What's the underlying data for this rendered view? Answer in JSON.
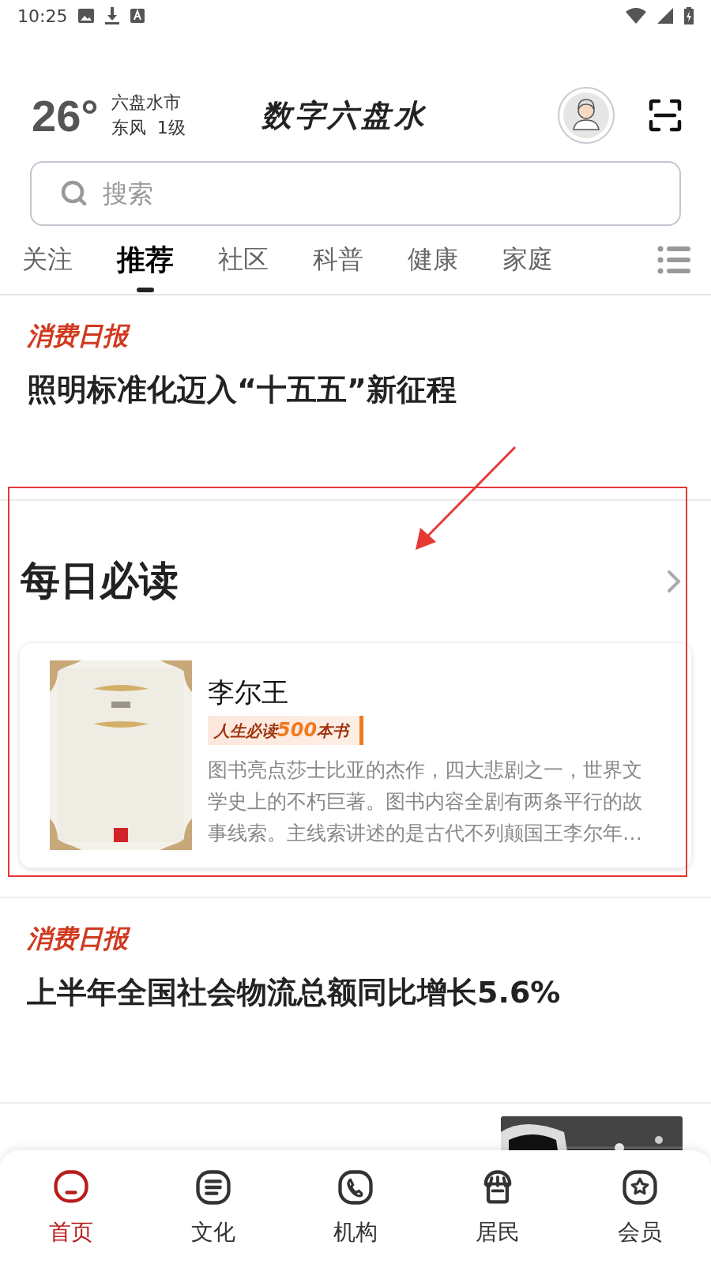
{
  "status_bar": {
    "time": "10:25"
  },
  "header": {
    "temperature": "26°",
    "city": "六盘水市",
    "wind": "东风  1级",
    "logo": "数字六盘水"
  },
  "search": {
    "placeholder": "搜索"
  },
  "tabs": [
    {
      "label": "关注",
      "selected": false
    },
    {
      "label": "推荐",
      "selected": true
    },
    {
      "label": "社区",
      "selected": false
    },
    {
      "label": "科普",
      "selected": false
    },
    {
      "label": "健康",
      "selected": false
    },
    {
      "label": "家庭",
      "selected": false
    }
  ],
  "feed": [
    {
      "kind": "article",
      "source": "消费日报",
      "title": "照明标准化迈入“十五五”新征程"
    },
    {
      "kind": "daily",
      "heading": "每日必读",
      "book": {
        "title": "李尔王",
        "badge": "人生必读",
        "badge_number": "500",
        "badge_suffix": "本书",
        "description": "图书亮点莎士比亚的杰作，四大悲剧之一，世界文学史上的不朽巨著。图书内容全剧有两条平行的故事线索。主线索讲述的是古代不列颠国王李尔年…"
      }
    },
    {
      "kind": "article",
      "source": "消费日报",
      "title": "上半年全国社会物流总额同比增长5.6%"
    },
    {
      "kind": "photo_article"
    }
  ],
  "nav": [
    {
      "label": "首页",
      "selected": true
    },
    {
      "label": "文化",
      "selected": false
    },
    {
      "label": "机构",
      "selected": false
    },
    {
      "label": "居民",
      "selected": false
    },
    {
      "label": "会员",
      "selected": false
    }
  ]
}
